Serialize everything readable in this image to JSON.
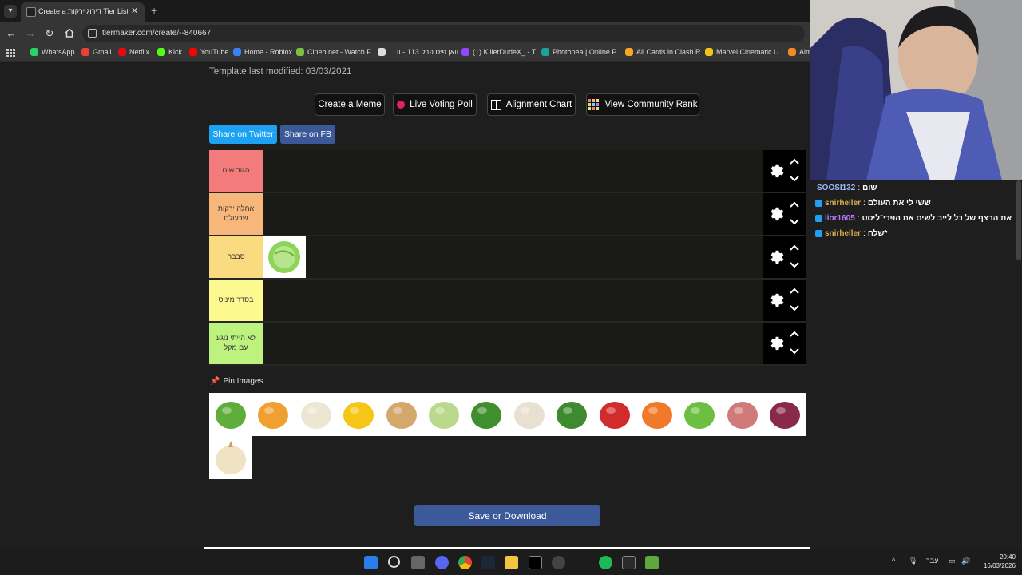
{
  "browser": {
    "tab_title": "Create a דירוג ירקות Tier List - T",
    "url": "tiermaker.com/create/--840667",
    "bookmarks": [
      {
        "label": "WhatsApp",
        "color": "#25d366"
      },
      {
        "label": "Gmail",
        "color": "#ea4335"
      },
      {
        "label": "Netflix",
        "color": "#e50914"
      },
      {
        "label": "Kick",
        "color": "#53fc18"
      },
      {
        "label": "YouTube",
        "color": "#ff0000"
      },
      {
        "label": "Home - Roblox",
        "color": "#3b82f6"
      },
      {
        "label": "Cineb.net - Watch F...",
        "color": "#7ac143"
      },
      {
        "label": "... וואן פיס פרק 113 - וו",
        "color": "#dddddd"
      },
      {
        "label": "(1) KillerDudeX_ - T...",
        "color": "#9146ff"
      },
      {
        "label": "Photopea | Online P...",
        "color": "#18a497"
      },
      {
        "label": "All Cards in Clash R...",
        "color": "#f5a623"
      },
      {
        "label": "Marvel Cinematic U...",
        "color": "#f0c419"
      },
      {
        "label": "Aim",
        "color": "#f08a24"
      }
    ]
  },
  "page": {
    "modified": "Template last modified: 03/03/2021",
    "buttons": {
      "create_meme": "Create a Meme",
      "live_poll": "Live Voting Poll",
      "alignment": "Alignment Chart",
      "community": "View Community Rank"
    },
    "share": {
      "twitter": "Share on Twitter",
      "fb": "Share on FB"
    },
    "tiers": [
      {
        "label": "הגוד שיט",
        "color": "#f47b7b"
      },
      {
        "label": "אחלה ירקות שבעולם",
        "color": "#f8b77a"
      },
      {
        "label": "סבבה",
        "color": "#fadb80"
      },
      {
        "label": "בסדר מינוס",
        "color": "#fcf990"
      },
      {
        "label": "לא הייתי נוגע עם מקל",
        "color": "#bdf27f"
      }
    ],
    "pin_label": "Pin Images",
    "pool_items": [
      "cucumber-image",
      "pumpkin-image",
      "cauliflower-image",
      "yellow-pepper-image",
      "potato-image",
      "kohlrabi-image",
      "broccoli-image",
      "garlic-image",
      "green-beans-image",
      "red-pepper-image",
      "carrot-image",
      "lettuce-image",
      "sweet-potato-image",
      "red-onion-image",
      "onion-image"
    ],
    "placed_item": "cabbage-image",
    "save": "Save or Download"
  },
  "chat": {
    "messages": [
      {
        "user": "SOOSI132",
        "text": "שום",
        "color": "#9ab8ff"
      },
      {
        "user": "snirheller",
        "text": "ששי לי את העולם",
        "color": "#d9b04a"
      },
      {
        "user": "lior1605",
        "text": "את הרצף של כל לייב לשים את הפרי־ליסט",
        "color": "#b77bff"
      },
      {
        "user": "snirheller",
        "text": "שלח*",
        "color": "#d9b04a"
      }
    ]
  },
  "taskbar": {
    "lang": "עבר",
    "time": "20:40",
    "date": "16/03/2026"
  }
}
